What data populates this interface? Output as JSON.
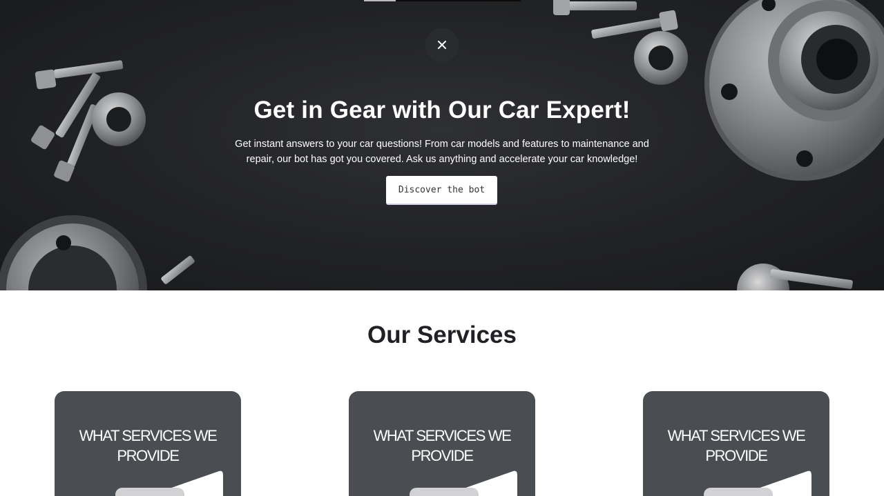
{
  "hero": {
    "close_icon": "close-icon",
    "title": "Get in Gear with Our Car Expert!",
    "description": "Get instant answers to your car questions! From car models and features to maintenance and repair, our bot has got you covered. Ask us anything and accelerate your car knowledge!",
    "cta_label": "Discover the bot"
  },
  "services": {
    "title": "Our Services",
    "cards": [
      {
        "title": "WHAT SERVICES WE PROVIDE"
      },
      {
        "title": "WHAT SERVICES WE PROVIDE"
      },
      {
        "title": "WHAT SERVICES WE PROVIDE"
      }
    ]
  },
  "colors": {
    "hero_background": "#232427",
    "card_background": "#4a4d51",
    "heading_text": "#1f2124",
    "white": "#ffffff"
  }
}
